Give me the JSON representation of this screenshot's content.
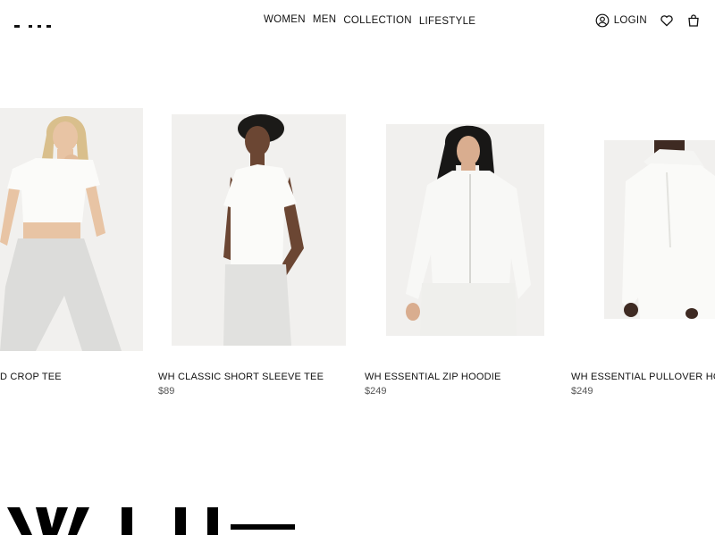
{
  "header": {
    "nav": [
      "WOMEN",
      "MEN",
      "COLLECTION",
      "LIFESTYLE"
    ],
    "login_label": "LOGIN"
  },
  "products": [
    {
      "name": "D CROP TEE",
      "price": ""
    },
    {
      "name": "WH CLASSIC SHORT SLEEVE TEE",
      "price": "$89"
    },
    {
      "name": "WH ESSENTIAL ZIP HOODIE",
      "price": "$249"
    },
    {
      "name": "WH ESSENTIAL PULLOVER HOO",
      "price": "$249"
    }
  ],
  "icons": {
    "user": "user-icon",
    "wishlist": "heart-icon",
    "cart": "bag-icon"
  },
  "colors": {
    "background": "#ffffff",
    "text": "#111111",
    "image_bg": "#f1f0ee",
    "garment": "#f7f7f5"
  }
}
